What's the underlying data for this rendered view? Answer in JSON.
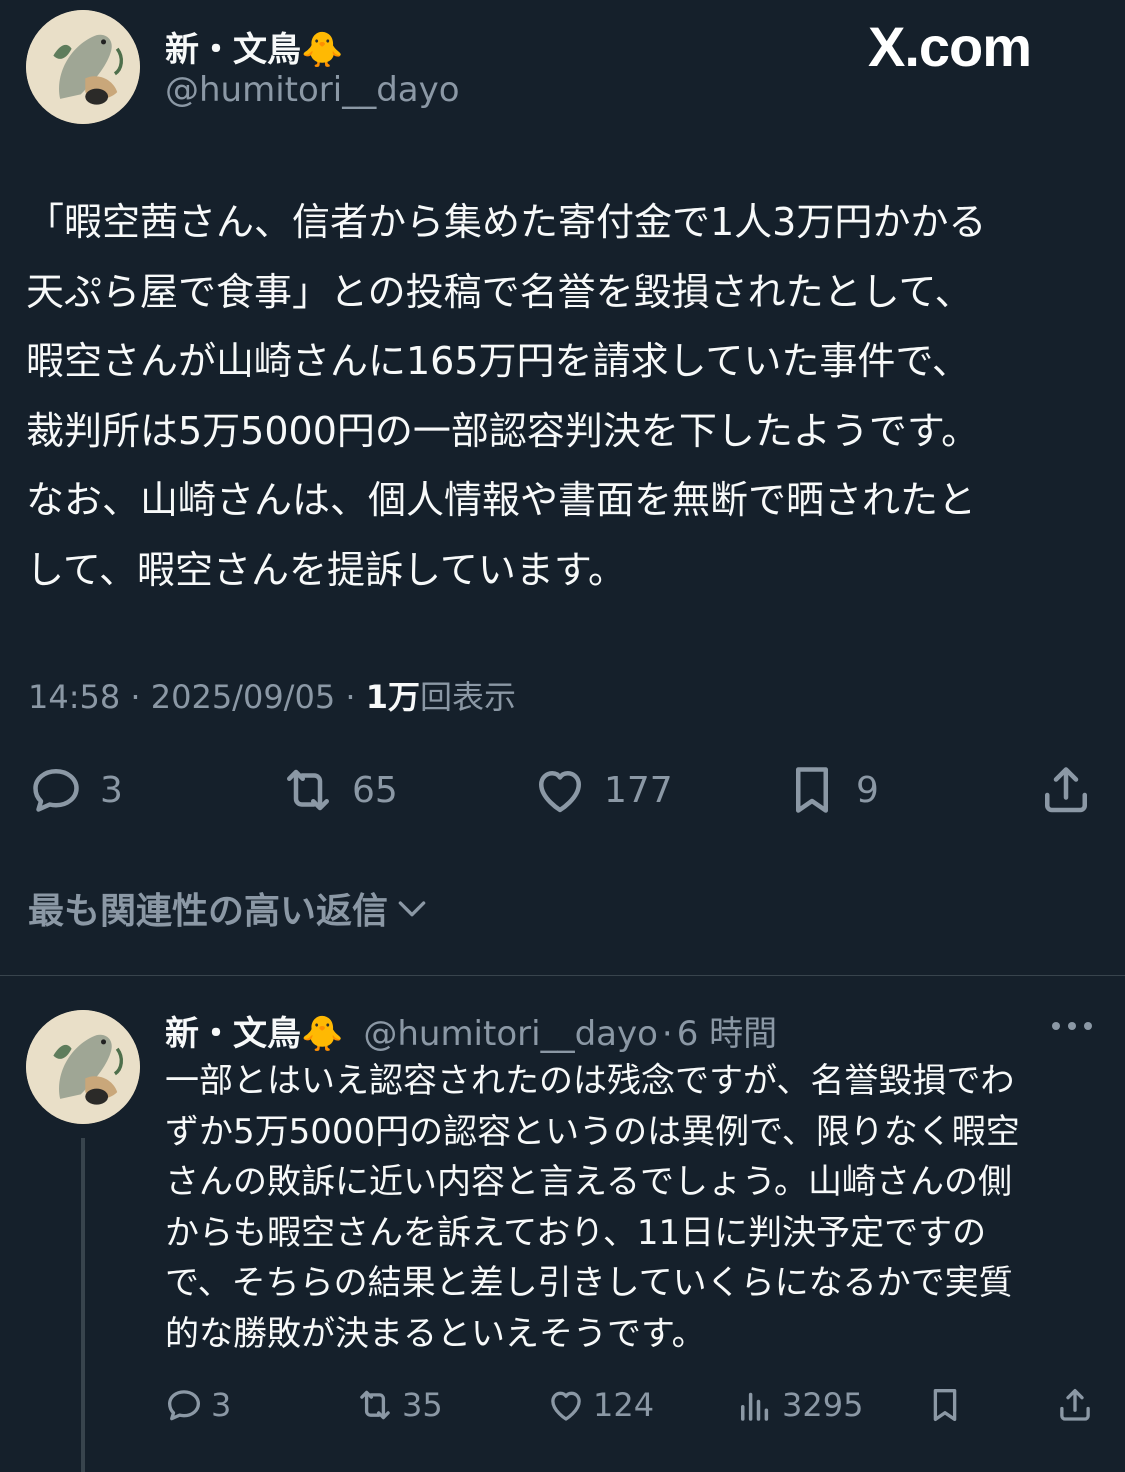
{
  "header": {
    "display_name": "新・文鳥🐥",
    "handle": "@humitori__dayo",
    "watermark": "X.com"
  },
  "tweet": {
    "lines": [
      "「暇空茜さん、信者から集めた寄付金で1人3万円かかる",
      "天ぷら屋で食事」との投稿で名誉を毀損されたとして、",
      "暇空さんが山崎さんに165万円を請求していた事件で、",
      "裁判所は5万5000円の一部認容判決を下したようです。",
      "なお、山崎さんは、個人情報や書面を無断で晒されたと",
      "して、暇空さんを提訴しています。"
    ],
    "time": "14:58",
    "date": "2025/09/05",
    "views_count": "1万",
    "views_label": "回表示",
    "dot": "·",
    "actions": {
      "replies": "3",
      "reposts": "65",
      "likes": "177",
      "bookmarks": "9"
    }
  },
  "relevant_replies_label": "最も関連性の高い返信",
  "reply": {
    "display_name": "新・文鳥🐥",
    "handle": "@humitori__dayo",
    "dot": "·",
    "time_ago": "6 時間",
    "lines": [
      "一部とはいえ認容されたのは残念ですが、名誉毀損でわ",
      "ずか5万5000円の認容というのは異例で、限りなく暇空",
      "さんの敗訴に近い内容と言えるでしょう。山崎さんの側",
      "からも暇空さんを訴えており、11日に判決予定ですの",
      "で、そちらの結果と差し引きしていくらになるかで実質",
      "的な勝敗が決まるといえそうです。"
    ],
    "actions": {
      "replies": "3",
      "reposts": "35",
      "likes": "124",
      "views": "3295"
    }
  },
  "icons": {
    "reply": "reply-icon",
    "repost": "repost-icon",
    "like": "heart-icon",
    "bookmark": "bookmark-icon",
    "share": "share-icon",
    "views": "views-icon",
    "more": "more-icon",
    "chevron": "chevron-down-icon"
  },
  "colors": {
    "background": "#15202b",
    "text": "#f7f9f9",
    "secondary": "#8b98a5",
    "divider": "#38444d"
  }
}
